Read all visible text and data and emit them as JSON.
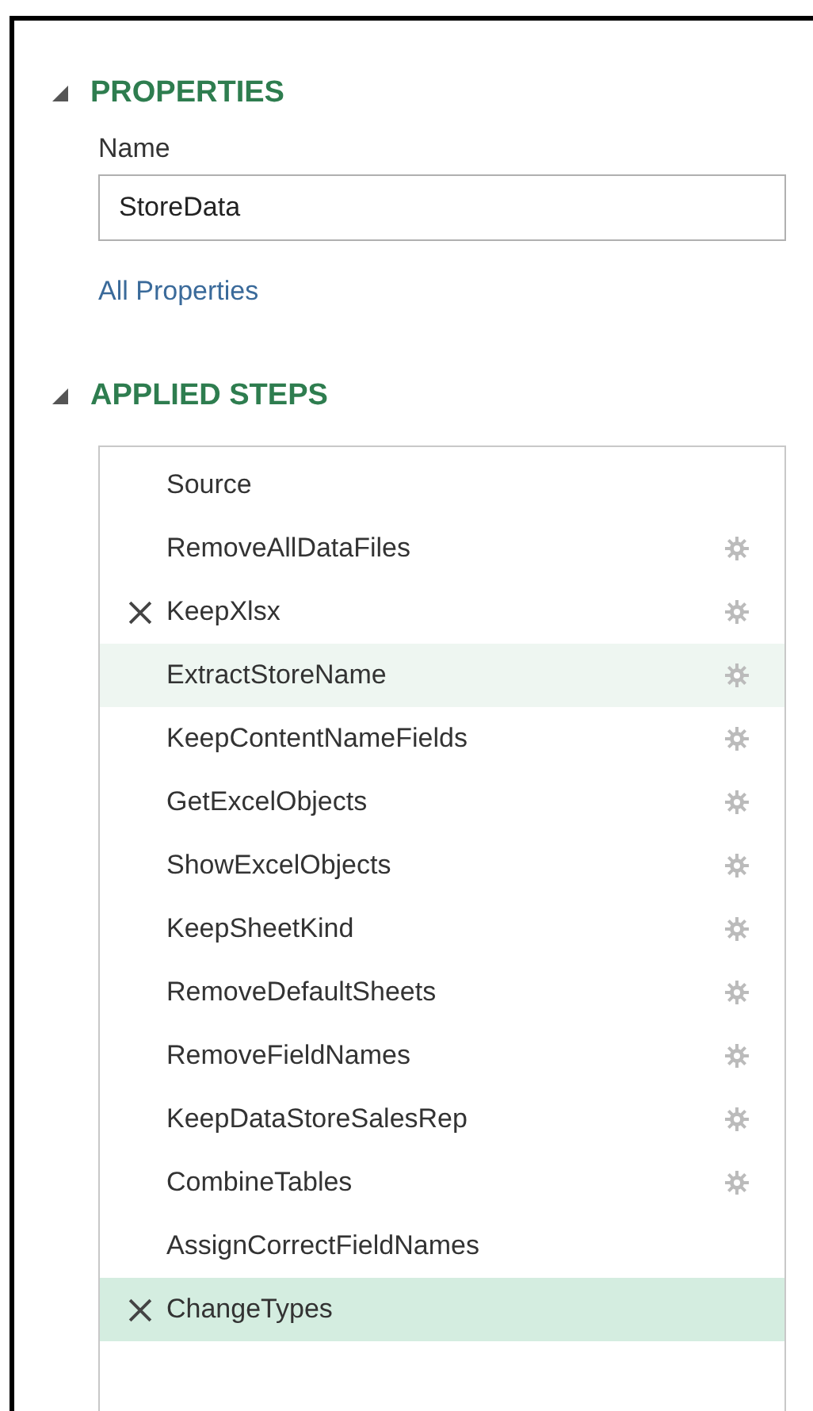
{
  "properties": {
    "heading": "PROPERTIES",
    "expanded": true,
    "name_label": "Name",
    "name_value": "StoreData",
    "link": "All Properties"
  },
  "applied_steps": {
    "heading": "APPLIED STEPS",
    "expanded": true,
    "steps": [
      {
        "name": "Source",
        "gear": false,
        "delete_icon": false,
        "hovered": false,
        "selected": false
      },
      {
        "name": "RemoveAllDataFiles",
        "gear": true,
        "delete_icon": false,
        "hovered": false,
        "selected": false
      },
      {
        "name": "KeepXlsx",
        "gear": true,
        "delete_icon": true,
        "hovered": false,
        "selected": false
      },
      {
        "name": "ExtractStoreName",
        "gear": true,
        "delete_icon": false,
        "hovered": true,
        "selected": false
      },
      {
        "name": "KeepContentNameFields",
        "gear": true,
        "delete_icon": false,
        "hovered": false,
        "selected": false
      },
      {
        "name": "GetExcelObjects",
        "gear": true,
        "delete_icon": false,
        "hovered": false,
        "selected": false
      },
      {
        "name": "ShowExcelObjects",
        "gear": true,
        "delete_icon": false,
        "hovered": false,
        "selected": false
      },
      {
        "name": "KeepSheetKind",
        "gear": true,
        "delete_icon": false,
        "hovered": false,
        "selected": false
      },
      {
        "name": "RemoveDefaultSheets",
        "gear": true,
        "delete_icon": false,
        "hovered": false,
        "selected": false
      },
      {
        "name": "RemoveFieldNames",
        "gear": true,
        "delete_icon": false,
        "hovered": false,
        "selected": false
      },
      {
        "name": "KeepDataStoreSalesRep",
        "gear": true,
        "delete_icon": false,
        "hovered": false,
        "selected": false
      },
      {
        "name": "CombineTables",
        "gear": true,
        "delete_icon": false,
        "hovered": false,
        "selected": false
      },
      {
        "name": "AssignCorrectFieldNames",
        "gear": false,
        "delete_icon": false,
        "hovered": false,
        "selected": false
      },
      {
        "name": "ChangeTypes",
        "gear": false,
        "delete_icon": true,
        "hovered": false,
        "selected": true
      }
    ]
  }
}
